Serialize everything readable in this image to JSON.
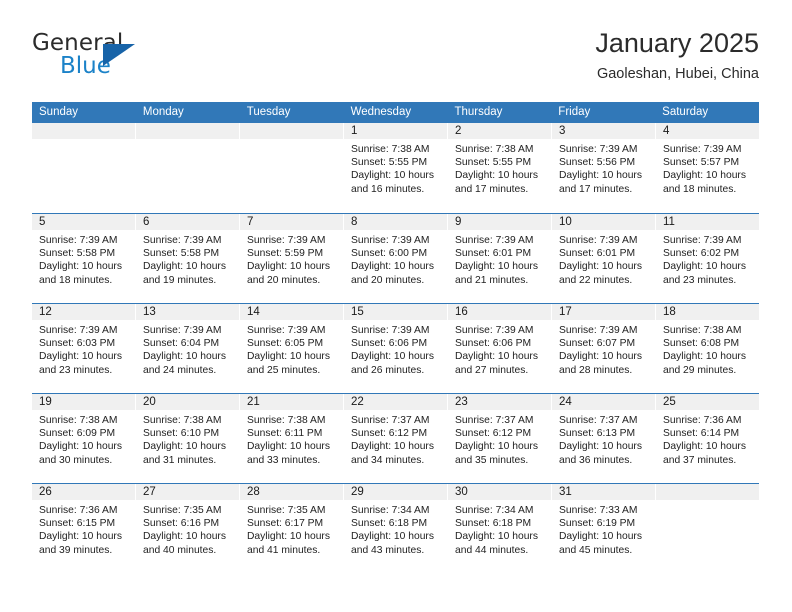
{
  "brand": {
    "name_part1": "General",
    "name_part2": "Blue",
    "triangle_color": "#1763a8",
    "blue_color": "#1b82c8"
  },
  "header": {
    "title": "January 2025",
    "subtitle": "Gaoleshan, Hubei, China"
  },
  "theme": {
    "header_blue": "#3178b8",
    "day_band_gray": "#f0f0f0",
    "text_color": "#222222"
  },
  "labels": {
    "sunrise_prefix": "Sunrise:",
    "sunset_prefix": "Sunset:",
    "daylight_prefix": "Daylight:"
  },
  "day_names": [
    "Sunday",
    "Monday",
    "Tuesday",
    "Wednesday",
    "Thursday",
    "Friday",
    "Saturday"
  ],
  "weeks": [
    [
      {
        "day": "",
        "empty": true
      },
      {
        "day": "",
        "empty": true
      },
      {
        "day": "",
        "empty": true
      },
      {
        "day": "1",
        "sunrise": "Sunrise: 7:38 AM",
        "sunset": "Sunset: 5:55 PM",
        "daylight_1": "Daylight: 10 hours",
        "daylight_2": "and 16 minutes."
      },
      {
        "day": "2",
        "sunrise": "Sunrise: 7:38 AM",
        "sunset": "Sunset: 5:55 PM",
        "daylight_1": "Daylight: 10 hours",
        "daylight_2": "and 17 minutes."
      },
      {
        "day": "3",
        "sunrise": "Sunrise: 7:39 AM",
        "sunset": "Sunset: 5:56 PM",
        "daylight_1": "Daylight: 10 hours",
        "daylight_2": "and 17 minutes."
      },
      {
        "day": "4",
        "sunrise": "Sunrise: 7:39 AM",
        "sunset": "Sunset: 5:57 PM",
        "daylight_1": "Daylight: 10 hours",
        "daylight_2": "and 18 minutes."
      }
    ],
    [
      {
        "day": "5",
        "sunrise": "Sunrise: 7:39 AM",
        "sunset": "Sunset: 5:58 PM",
        "daylight_1": "Daylight: 10 hours",
        "daylight_2": "and 18 minutes."
      },
      {
        "day": "6",
        "sunrise": "Sunrise: 7:39 AM",
        "sunset": "Sunset: 5:58 PM",
        "daylight_1": "Daylight: 10 hours",
        "daylight_2": "and 19 minutes."
      },
      {
        "day": "7",
        "sunrise": "Sunrise: 7:39 AM",
        "sunset": "Sunset: 5:59 PM",
        "daylight_1": "Daylight: 10 hours",
        "daylight_2": "and 20 minutes."
      },
      {
        "day": "8",
        "sunrise": "Sunrise: 7:39 AM",
        "sunset": "Sunset: 6:00 PM",
        "daylight_1": "Daylight: 10 hours",
        "daylight_2": "and 20 minutes."
      },
      {
        "day": "9",
        "sunrise": "Sunrise: 7:39 AM",
        "sunset": "Sunset: 6:01 PM",
        "daylight_1": "Daylight: 10 hours",
        "daylight_2": "and 21 minutes."
      },
      {
        "day": "10",
        "sunrise": "Sunrise: 7:39 AM",
        "sunset": "Sunset: 6:01 PM",
        "daylight_1": "Daylight: 10 hours",
        "daylight_2": "and 22 minutes."
      },
      {
        "day": "11",
        "sunrise": "Sunrise: 7:39 AM",
        "sunset": "Sunset: 6:02 PM",
        "daylight_1": "Daylight: 10 hours",
        "daylight_2": "and 23 minutes."
      }
    ],
    [
      {
        "day": "12",
        "sunrise": "Sunrise: 7:39 AM",
        "sunset": "Sunset: 6:03 PM",
        "daylight_1": "Daylight: 10 hours",
        "daylight_2": "and 23 minutes."
      },
      {
        "day": "13",
        "sunrise": "Sunrise: 7:39 AM",
        "sunset": "Sunset: 6:04 PM",
        "daylight_1": "Daylight: 10 hours",
        "daylight_2": "and 24 minutes."
      },
      {
        "day": "14",
        "sunrise": "Sunrise: 7:39 AM",
        "sunset": "Sunset: 6:05 PM",
        "daylight_1": "Daylight: 10 hours",
        "daylight_2": "and 25 minutes."
      },
      {
        "day": "15",
        "sunrise": "Sunrise: 7:39 AM",
        "sunset": "Sunset: 6:06 PM",
        "daylight_1": "Daylight: 10 hours",
        "daylight_2": "and 26 minutes."
      },
      {
        "day": "16",
        "sunrise": "Sunrise: 7:39 AM",
        "sunset": "Sunset: 6:06 PM",
        "daylight_1": "Daylight: 10 hours",
        "daylight_2": "and 27 minutes."
      },
      {
        "day": "17",
        "sunrise": "Sunrise: 7:39 AM",
        "sunset": "Sunset: 6:07 PM",
        "daylight_1": "Daylight: 10 hours",
        "daylight_2": "and 28 minutes."
      },
      {
        "day": "18",
        "sunrise": "Sunrise: 7:38 AM",
        "sunset": "Sunset: 6:08 PM",
        "daylight_1": "Daylight: 10 hours",
        "daylight_2": "and 29 minutes."
      }
    ],
    [
      {
        "day": "19",
        "sunrise": "Sunrise: 7:38 AM",
        "sunset": "Sunset: 6:09 PM",
        "daylight_1": "Daylight: 10 hours",
        "daylight_2": "and 30 minutes."
      },
      {
        "day": "20",
        "sunrise": "Sunrise: 7:38 AM",
        "sunset": "Sunset: 6:10 PM",
        "daylight_1": "Daylight: 10 hours",
        "daylight_2": "and 31 minutes."
      },
      {
        "day": "21",
        "sunrise": "Sunrise: 7:38 AM",
        "sunset": "Sunset: 6:11 PM",
        "daylight_1": "Daylight: 10 hours",
        "daylight_2": "and 33 minutes."
      },
      {
        "day": "22",
        "sunrise": "Sunrise: 7:37 AM",
        "sunset": "Sunset: 6:12 PM",
        "daylight_1": "Daylight: 10 hours",
        "daylight_2": "and 34 minutes."
      },
      {
        "day": "23",
        "sunrise": "Sunrise: 7:37 AM",
        "sunset": "Sunset: 6:12 PM",
        "daylight_1": "Daylight: 10 hours",
        "daylight_2": "and 35 minutes."
      },
      {
        "day": "24",
        "sunrise": "Sunrise: 7:37 AM",
        "sunset": "Sunset: 6:13 PM",
        "daylight_1": "Daylight: 10 hours",
        "daylight_2": "and 36 minutes."
      },
      {
        "day": "25",
        "sunrise": "Sunrise: 7:36 AM",
        "sunset": "Sunset: 6:14 PM",
        "daylight_1": "Daylight: 10 hours",
        "daylight_2": "and 37 minutes."
      }
    ],
    [
      {
        "day": "26",
        "sunrise": "Sunrise: 7:36 AM",
        "sunset": "Sunset: 6:15 PM",
        "daylight_1": "Daylight: 10 hours",
        "daylight_2": "and 39 minutes."
      },
      {
        "day": "27",
        "sunrise": "Sunrise: 7:35 AM",
        "sunset": "Sunset: 6:16 PM",
        "daylight_1": "Daylight: 10 hours",
        "daylight_2": "and 40 minutes."
      },
      {
        "day": "28",
        "sunrise": "Sunrise: 7:35 AM",
        "sunset": "Sunset: 6:17 PM",
        "daylight_1": "Daylight: 10 hours",
        "daylight_2": "and 41 minutes."
      },
      {
        "day": "29",
        "sunrise": "Sunrise: 7:34 AM",
        "sunset": "Sunset: 6:18 PM",
        "daylight_1": "Daylight: 10 hours",
        "daylight_2": "and 43 minutes."
      },
      {
        "day": "30",
        "sunrise": "Sunrise: 7:34 AM",
        "sunset": "Sunset: 6:18 PM",
        "daylight_1": "Daylight: 10 hours",
        "daylight_2": "and 44 minutes."
      },
      {
        "day": "31",
        "sunrise": "Sunrise: 7:33 AM",
        "sunset": "Sunset: 6:19 PM",
        "daylight_1": "Daylight: 10 hours",
        "daylight_2": "and 45 minutes."
      },
      {
        "day": "",
        "empty": true
      }
    ]
  ]
}
